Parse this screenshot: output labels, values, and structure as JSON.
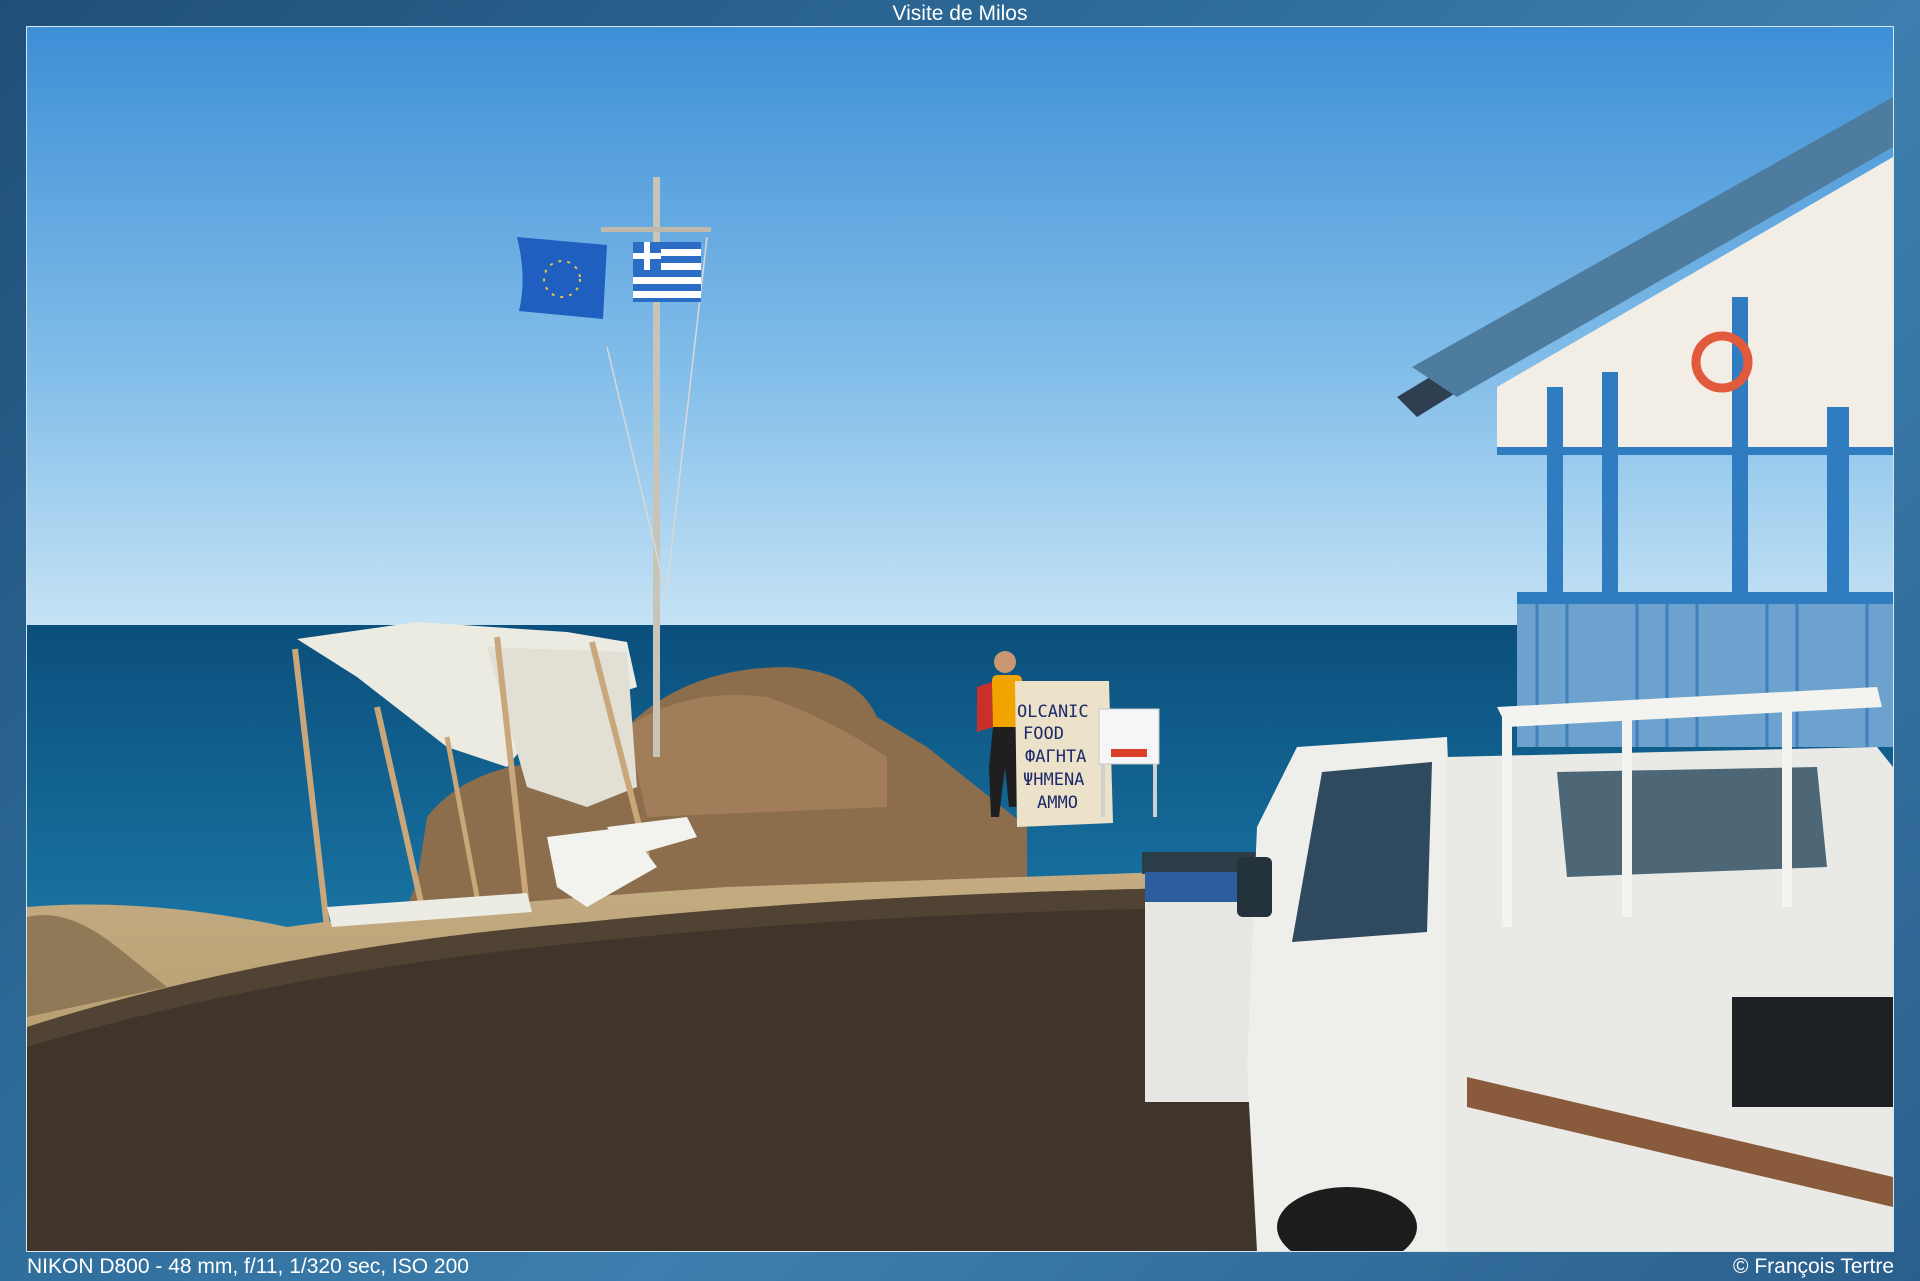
{
  "gallery": {
    "title": "Visite de Milos",
    "exif": "NIKON D800 - 48 mm, f/11, 1/320 sec, ISO 200",
    "copyright": "© François Tertre"
  },
  "photo": {
    "sign_lines": [
      "OLCANIC",
      "FOOD",
      "ФАГНТА",
      "ΨΗΜΕΝΑ",
      "ΑΜΜΟ"
    ],
    "colors": {
      "sky_top": "#3d8fd6",
      "sky_bottom": "#bfe0f5",
      "sea": "#0f5a86",
      "sand": "#b49a72",
      "shadow": "#3f362c",
      "porch_blue": "#2f7cc0",
      "truck_white": "#eeeeea"
    }
  }
}
